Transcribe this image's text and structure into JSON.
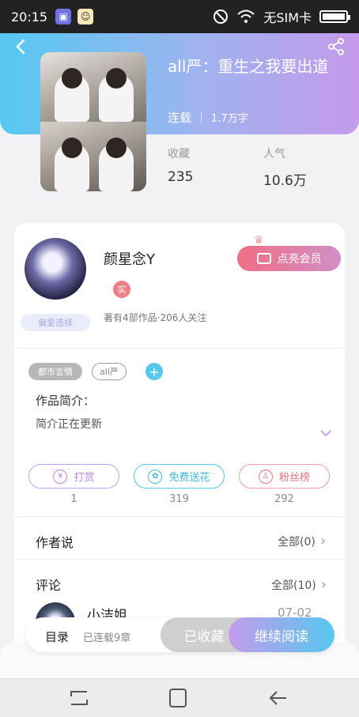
{
  "status_bar": {
    "time": "20:15",
    "carrier": "无SIM卡"
  },
  "book": {
    "title": "all严：重生之我要出道",
    "status": "连载",
    "word_count": "1.7万字",
    "stats": [
      {
        "label": "收藏",
        "value": "235"
      },
      {
        "label": "人气",
        "value": "10.6万"
      }
    ]
  },
  "author": {
    "name": "颜星念Y",
    "real_badge": "实",
    "info": "著有4部作品·206人关注",
    "cute_badge": "偏爱选择",
    "vip_button": "点亮会员"
  },
  "tags": [
    "都市言情",
    "all严"
  ],
  "intro": {
    "title": "作品简介：",
    "body": "简介正在更新"
  },
  "actions": [
    {
      "label": "打赏",
      "count": "1",
      "icon": "¥"
    },
    {
      "label": "免费送花",
      "count": "319",
      "icon": "✿"
    },
    {
      "label": "粉丝榜",
      "count": "292",
      "icon": "♙"
    }
  ],
  "author_says": {
    "title": "作者说",
    "more": "全部(0)"
  },
  "comments": {
    "title": "评论",
    "more": "全部(10)",
    "first": {
      "name": "小洁姐",
      "date": "07-02"
    }
  },
  "read_bar": {
    "toc": "目录",
    "chapters": "已连载9章",
    "saved": "已收藏",
    "continue": "继续阅读"
  },
  "colors": {
    "header_gradient_start": "#55c9f1",
    "header_gradient_end": "#c59aeb",
    "vip_pink": "#f06e82",
    "accent_purple": "#b884e0",
    "accent_blue": "#3fb8e3"
  }
}
